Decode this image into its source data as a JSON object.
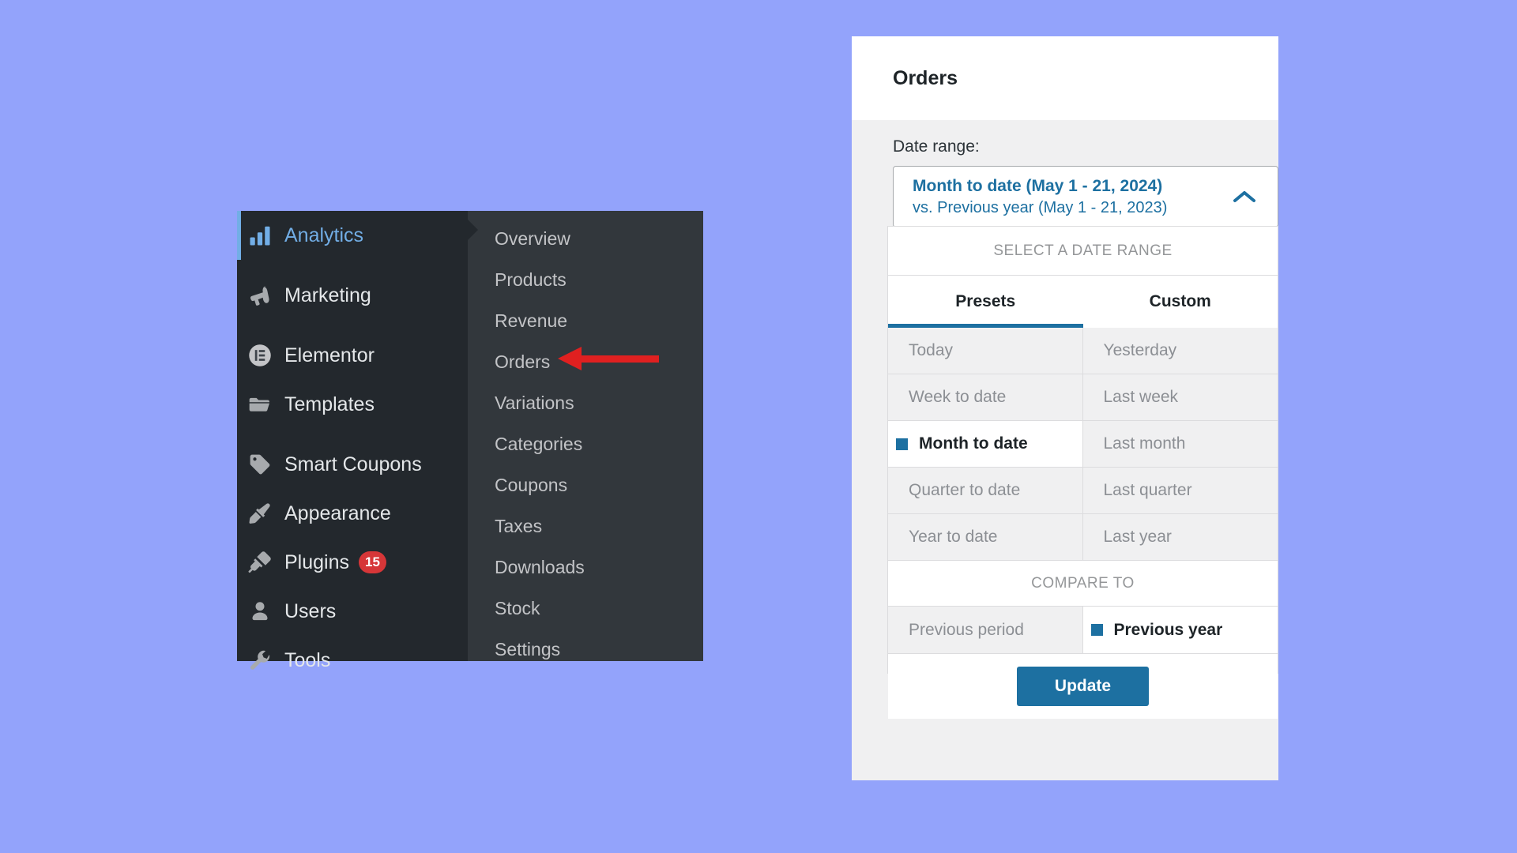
{
  "theme": {
    "page_background": "#93a3fb",
    "menu_background": "#23282d",
    "submenu_background": "#32373c",
    "accent_blue": "#1d70a1",
    "active_menu_blue": "#72aee6",
    "badge_red": "#d63638",
    "arrow_red": "#e02020"
  },
  "admin_menu": {
    "items": [
      {
        "label": "Analytics",
        "icon": "chart-bar-icon",
        "active": true,
        "badge": null,
        "gap_after": true
      },
      {
        "label": "Marketing",
        "icon": "megaphone-icon",
        "active": false,
        "badge": null,
        "gap_after": true
      },
      {
        "label": "Elementor",
        "icon": "elementor-icon",
        "active": false,
        "badge": null,
        "gap_after": false
      },
      {
        "label": "Templates",
        "icon": "folder-icon",
        "active": false,
        "badge": null,
        "gap_after": true
      },
      {
        "label": "Smart Coupons",
        "icon": "tag-icon",
        "active": false,
        "badge": null,
        "gap_after": false
      },
      {
        "label": "Appearance",
        "icon": "paintbrush-icon",
        "active": false,
        "badge": null,
        "gap_after": false
      },
      {
        "label": "Plugins",
        "icon": "plug-icon",
        "active": false,
        "badge": "15",
        "gap_after": false
      },
      {
        "label": "Users",
        "icon": "user-icon",
        "active": false,
        "badge": null,
        "gap_after": false
      },
      {
        "label": "Tools",
        "icon": "wrench-icon",
        "active": false,
        "badge": null,
        "gap_after": false
      }
    ]
  },
  "admin_submenu": {
    "parent": "Analytics",
    "items": [
      {
        "label": "Overview",
        "current": false
      },
      {
        "label": "Products",
        "current": false
      },
      {
        "label": "Revenue",
        "current": false
      },
      {
        "label": "Orders",
        "current": false
      },
      {
        "label": "Variations",
        "current": false
      },
      {
        "label": "Categories",
        "current": false
      },
      {
        "label": "Coupons",
        "current": false
      },
      {
        "label": "Taxes",
        "current": false
      },
      {
        "label": "Downloads",
        "current": false
      },
      {
        "label": "Stock",
        "current": false
      },
      {
        "label": "Settings",
        "current": false
      }
    ]
  },
  "annotation": {
    "arrow": "red-left-arrow",
    "points_at": "Orders"
  },
  "panel": {
    "title": "Orders",
    "date_range_label": "Date range:",
    "selected_range": {
      "primary": "Month to date (May 1 - 21, 2024)",
      "secondary": "vs. Previous year (May 1 - 21, 2023)"
    },
    "toggle_icon": "chevron-up-icon"
  },
  "date_picker": {
    "header": "SELECT A DATE RANGE",
    "tabs": [
      {
        "label": "Presets",
        "active": true
      },
      {
        "label": "Custom",
        "active": false
      }
    ],
    "presets": [
      {
        "label": "Today",
        "selected": false
      },
      {
        "label": "Yesterday",
        "selected": false
      },
      {
        "label": "Week to date",
        "selected": false
      },
      {
        "label": "Last week",
        "selected": false
      },
      {
        "label": "Month to date",
        "selected": true
      },
      {
        "label": "Last month",
        "selected": false
      },
      {
        "label": "Quarter to date",
        "selected": false
      },
      {
        "label": "Last quarter",
        "selected": false
      },
      {
        "label": "Year to date",
        "selected": false
      },
      {
        "label": "Last year",
        "selected": false
      }
    ],
    "compare_header": "COMPARE TO",
    "compare_options": [
      {
        "label": "Previous period",
        "selected": false
      },
      {
        "label": "Previous year",
        "selected": true
      }
    ],
    "update_button": "Update"
  }
}
